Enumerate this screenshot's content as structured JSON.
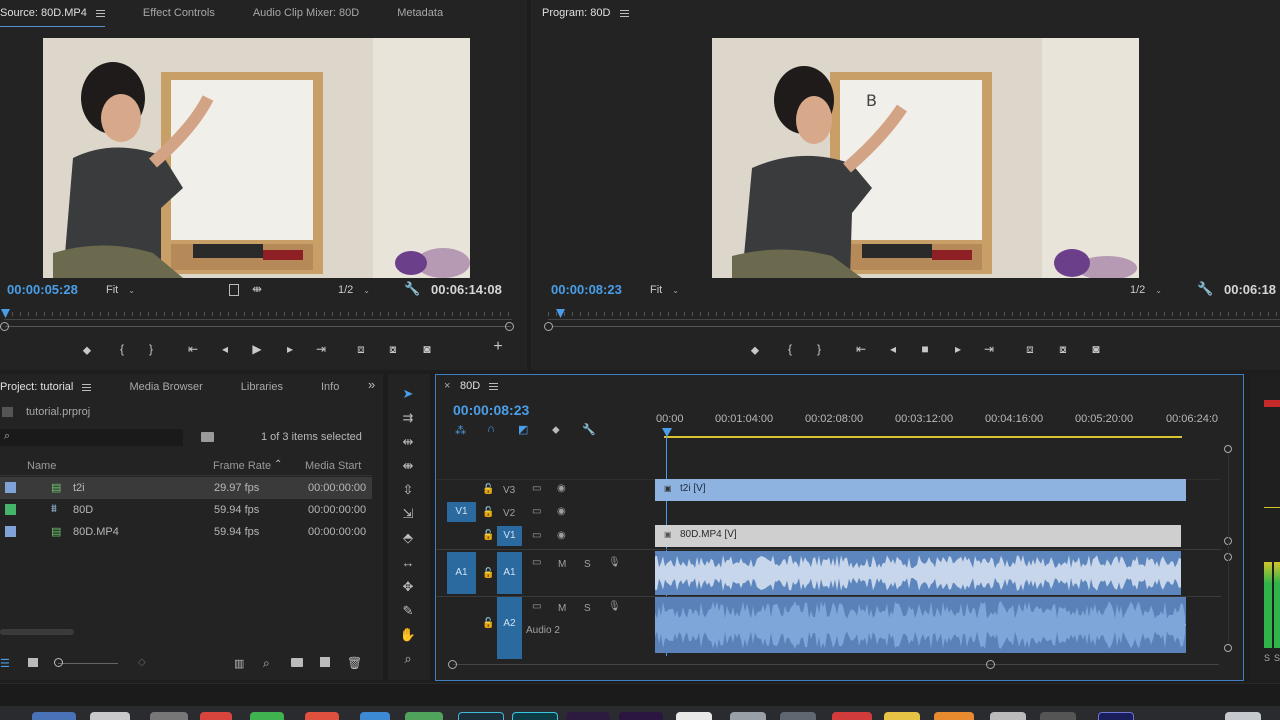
{
  "source": {
    "tabs": [
      "Source: 80D.MP4",
      "Effect Controls",
      "Audio Clip Mixer: 80D",
      "Metadata"
    ],
    "timecode_in": "00:00:05:28",
    "fit": "Fit",
    "resolution": "1/2",
    "timecode_duration": "00:06:14:08"
  },
  "program": {
    "tab": "Program: 80D",
    "timecode": "00:00:08:23",
    "fit": "Fit",
    "resolution": "1/2",
    "timecode_right": "00:06:18"
  },
  "project": {
    "tabs": [
      "Project: tutorial",
      "Media Browser",
      "Libraries",
      "Info"
    ],
    "overflow": "»",
    "file": "tutorial.prproj",
    "search_placeholder": "",
    "selection": "1 of 3 items selected",
    "columns": [
      "Name",
      "Frame Rate",
      "Media Start"
    ],
    "items": [
      {
        "name": "t2i",
        "rate": "29.97 fps",
        "start": "00:00:00:00",
        "color": "#7fa3d6"
      },
      {
        "name": "80D",
        "rate": "59.94 fps",
        "start": "00:00:00:00",
        "color": "#45b36a"
      },
      {
        "name": "80D.MP4",
        "rate": "59.94 fps",
        "start": "00:00:00:00",
        "color": "#7fa3d6"
      }
    ]
  },
  "timeline": {
    "close": "×",
    "tab": "80D",
    "timecode": "00:00:08:23",
    "ruler": [
      "00:00",
      "00:01:04:00",
      "00:02:08:00",
      "00:03:12:00",
      "00:04:16:00",
      "00:05:20:00",
      "00:06:24:0"
    ],
    "tracks": {
      "v3": "V3",
      "v2": "V2",
      "v1": "V1",
      "v1_patch": "V1",
      "a1": "A1",
      "a1_patch": "A1",
      "a2": "A2",
      "a2_name": "Audio 2",
      "m": "M",
      "s": "S"
    },
    "clips": {
      "t2i": "t2i [V]",
      "mp4": "80D.MP4 [V]"
    }
  },
  "meters": {
    "s": "S",
    "s2": "S"
  }
}
